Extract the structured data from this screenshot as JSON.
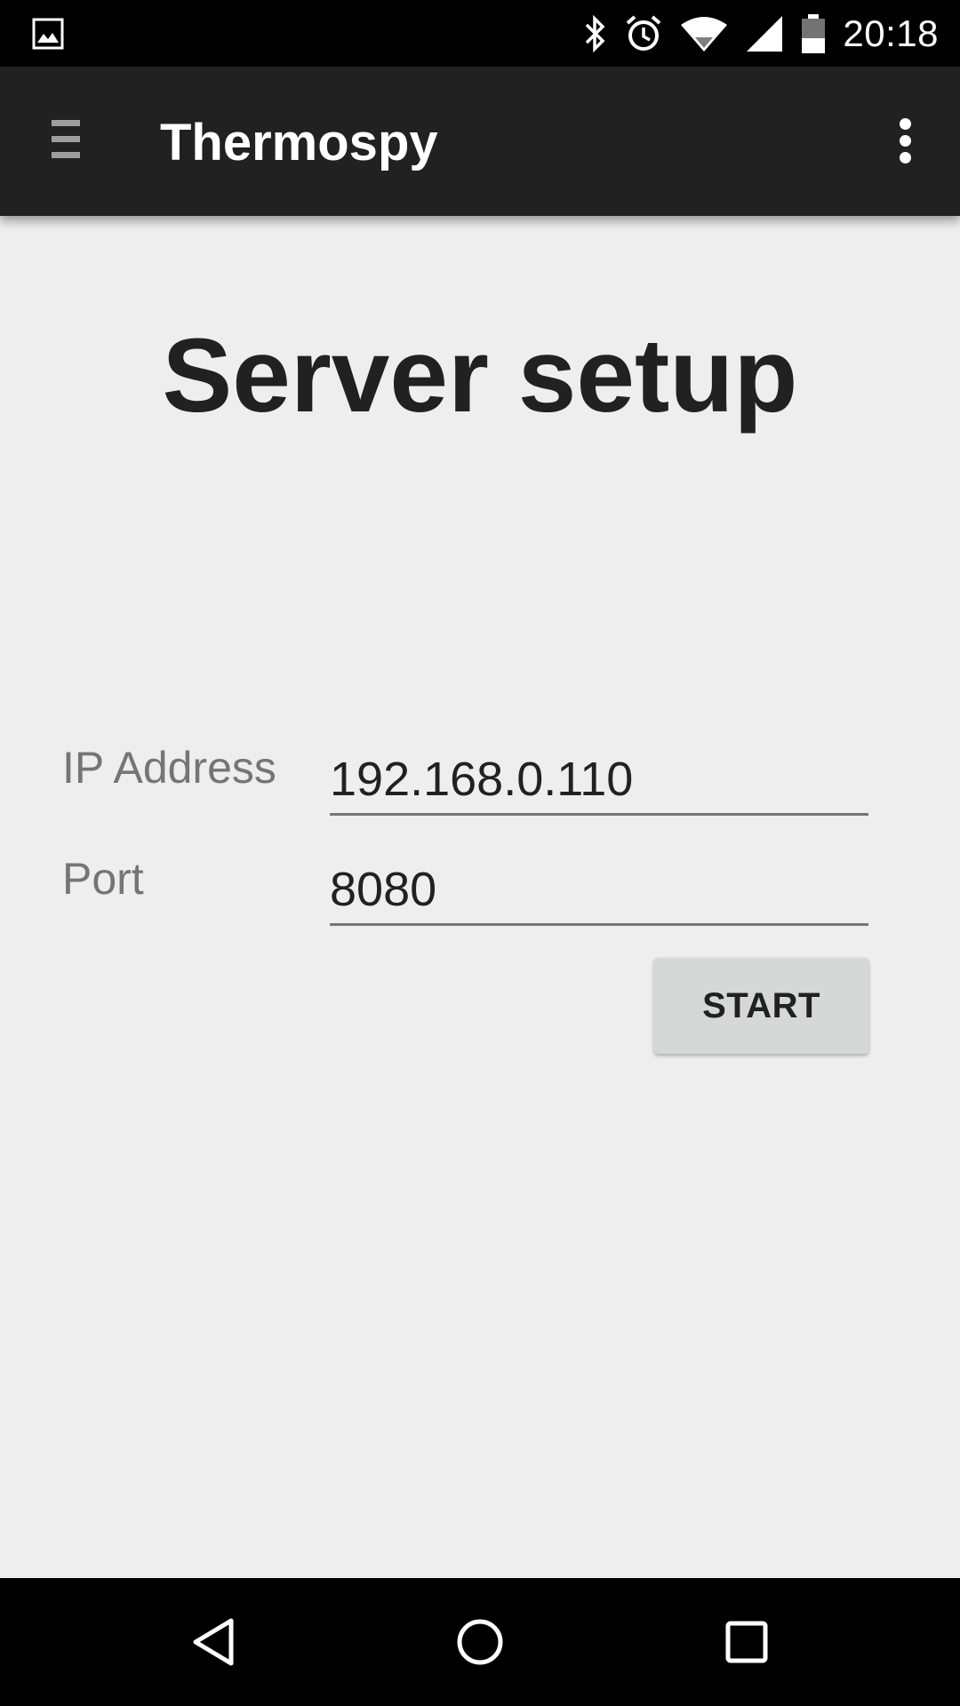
{
  "status_bar": {
    "time": "20:18",
    "icons": [
      "gallery-icon",
      "bluetooth-icon",
      "alarm-icon",
      "wifi-icon",
      "signal-icon",
      "battery-icon"
    ]
  },
  "app_bar": {
    "title": "Thermospy",
    "menu_icon": "hamburger-menu-icon",
    "overflow_icon": "more-vert-icon"
  },
  "main": {
    "heading": "Server setup",
    "ip_field": {
      "label": "IP Address",
      "value": "192.168.0.110"
    },
    "port_field": {
      "label": "Port",
      "value": "8080"
    },
    "start_button": "START"
  },
  "nav_bar": {
    "icons": [
      "back-icon",
      "home-icon",
      "recents-icon"
    ]
  },
  "colors": {
    "status_bar_bg": "#000000",
    "app_bar_bg": "#212121",
    "page_bg": "#eeeeee",
    "button_bg": "#d6d7d7",
    "label_text": "#757575"
  }
}
